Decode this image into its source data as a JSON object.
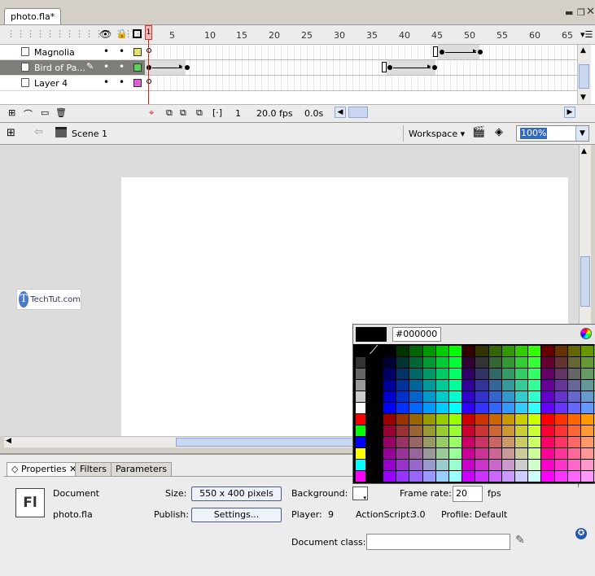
{
  "document_tab": {
    "title": "photo.fla*"
  },
  "timeline": {
    "ruler_ticks": [
      "1",
      "5",
      "10",
      "15",
      "20",
      "25",
      "30",
      "35",
      "40",
      "45",
      "50",
      "55",
      "60",
      "65"
    ],
    "layers": [
      {
        "name": "Magnolia",
        "color": "#e6e36a"
      },
      {
        "name": "Bird of Pa...",
        "color": "#5ad45a"
      },
      {
        "name": "Layer 4",
        "color": "#e05cd8"
      }
    ],
    "current_frame": "1",
    "fps": "20.0 fps",
    "elapsed": "0.0s"
  },
  "edit_bar": {
    "scene": "Scene 1",
    "workspace": "Workspace",
    "zoom": "100%"
  },
  "watermark": {
    "text": "TechTut.com",
    "logo_letter": "T"
  },
  "color_picker": {
    "hex": "#000000",
    "left_column": [
      "#000000",
      "#333333",
      "#666666",
      "#999999",
      "#cccccc",
      "#ffffff",
      "#ff0000",
      "#00ff00",
      "#0000ff",
      "#ffff00",
      "#00ffff",
      "#ff00ff"
    ]
  },
  "properties": {
    "tabs": [
      "Properties",
      "Filters",
      "Parameters"
    ],
    "doc_type": "Document",
    "doc_name": "photo.fla",
    "icon_text": "Fl",
    "size_label": "Size:",
    "size_value": "550 x 400 pixels",
    "publish_label": "Publish:",
    "settings_button": "Settings...",
    "background_label": "Background:",
    "frame_rate_label": "Frame rate:",
    "frame_rate_value": "20",
    "fps_unit": "fps",
    "player_label": "Player:",
    "player_value": "9",
    "actionscript_label": "ActionScript:",
    "actionscript_value": "3.0",
    "profile_label": "Profile:",
    "profile_value": "Default",
    "document_class_label": "Document class:",
    "document_class_value": ""
  }
}
